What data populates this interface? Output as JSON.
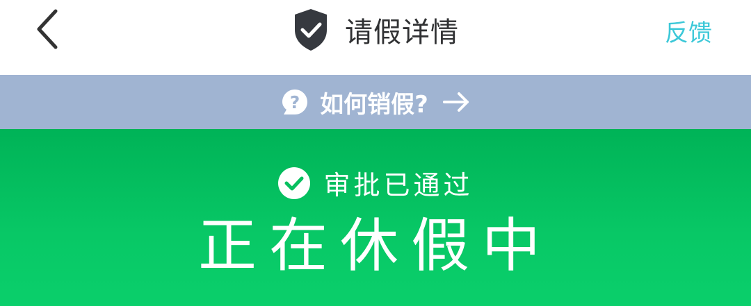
{
  "header": {
    "title": "请假详情",
    "feedback_label": "反馈",
    "back_icon": "chevron-left-icon",
    "title_icon": "shield-check-icon"
  },
  "help_bar": {
    "text": "如何销假?",
    "icon": "question-bubble-icon",
    "arrow_icon": "arrow-right-icon"
  },
  "status": {
    "approval_text": "审批已通过",
    "approval_icon": "check-circle-icon",
    "main_text": "正在休假中"
  },
  "colors": {
    "accent": "#3cc8d8",
    "help_bar_bg": "#a0b4d2",
    "status_green_top": "#00b357",
    "status_green_bottom": "#0acf6b",
    "title_text": "#303133",
    "shield_fill": "#36393f"
  }
}
